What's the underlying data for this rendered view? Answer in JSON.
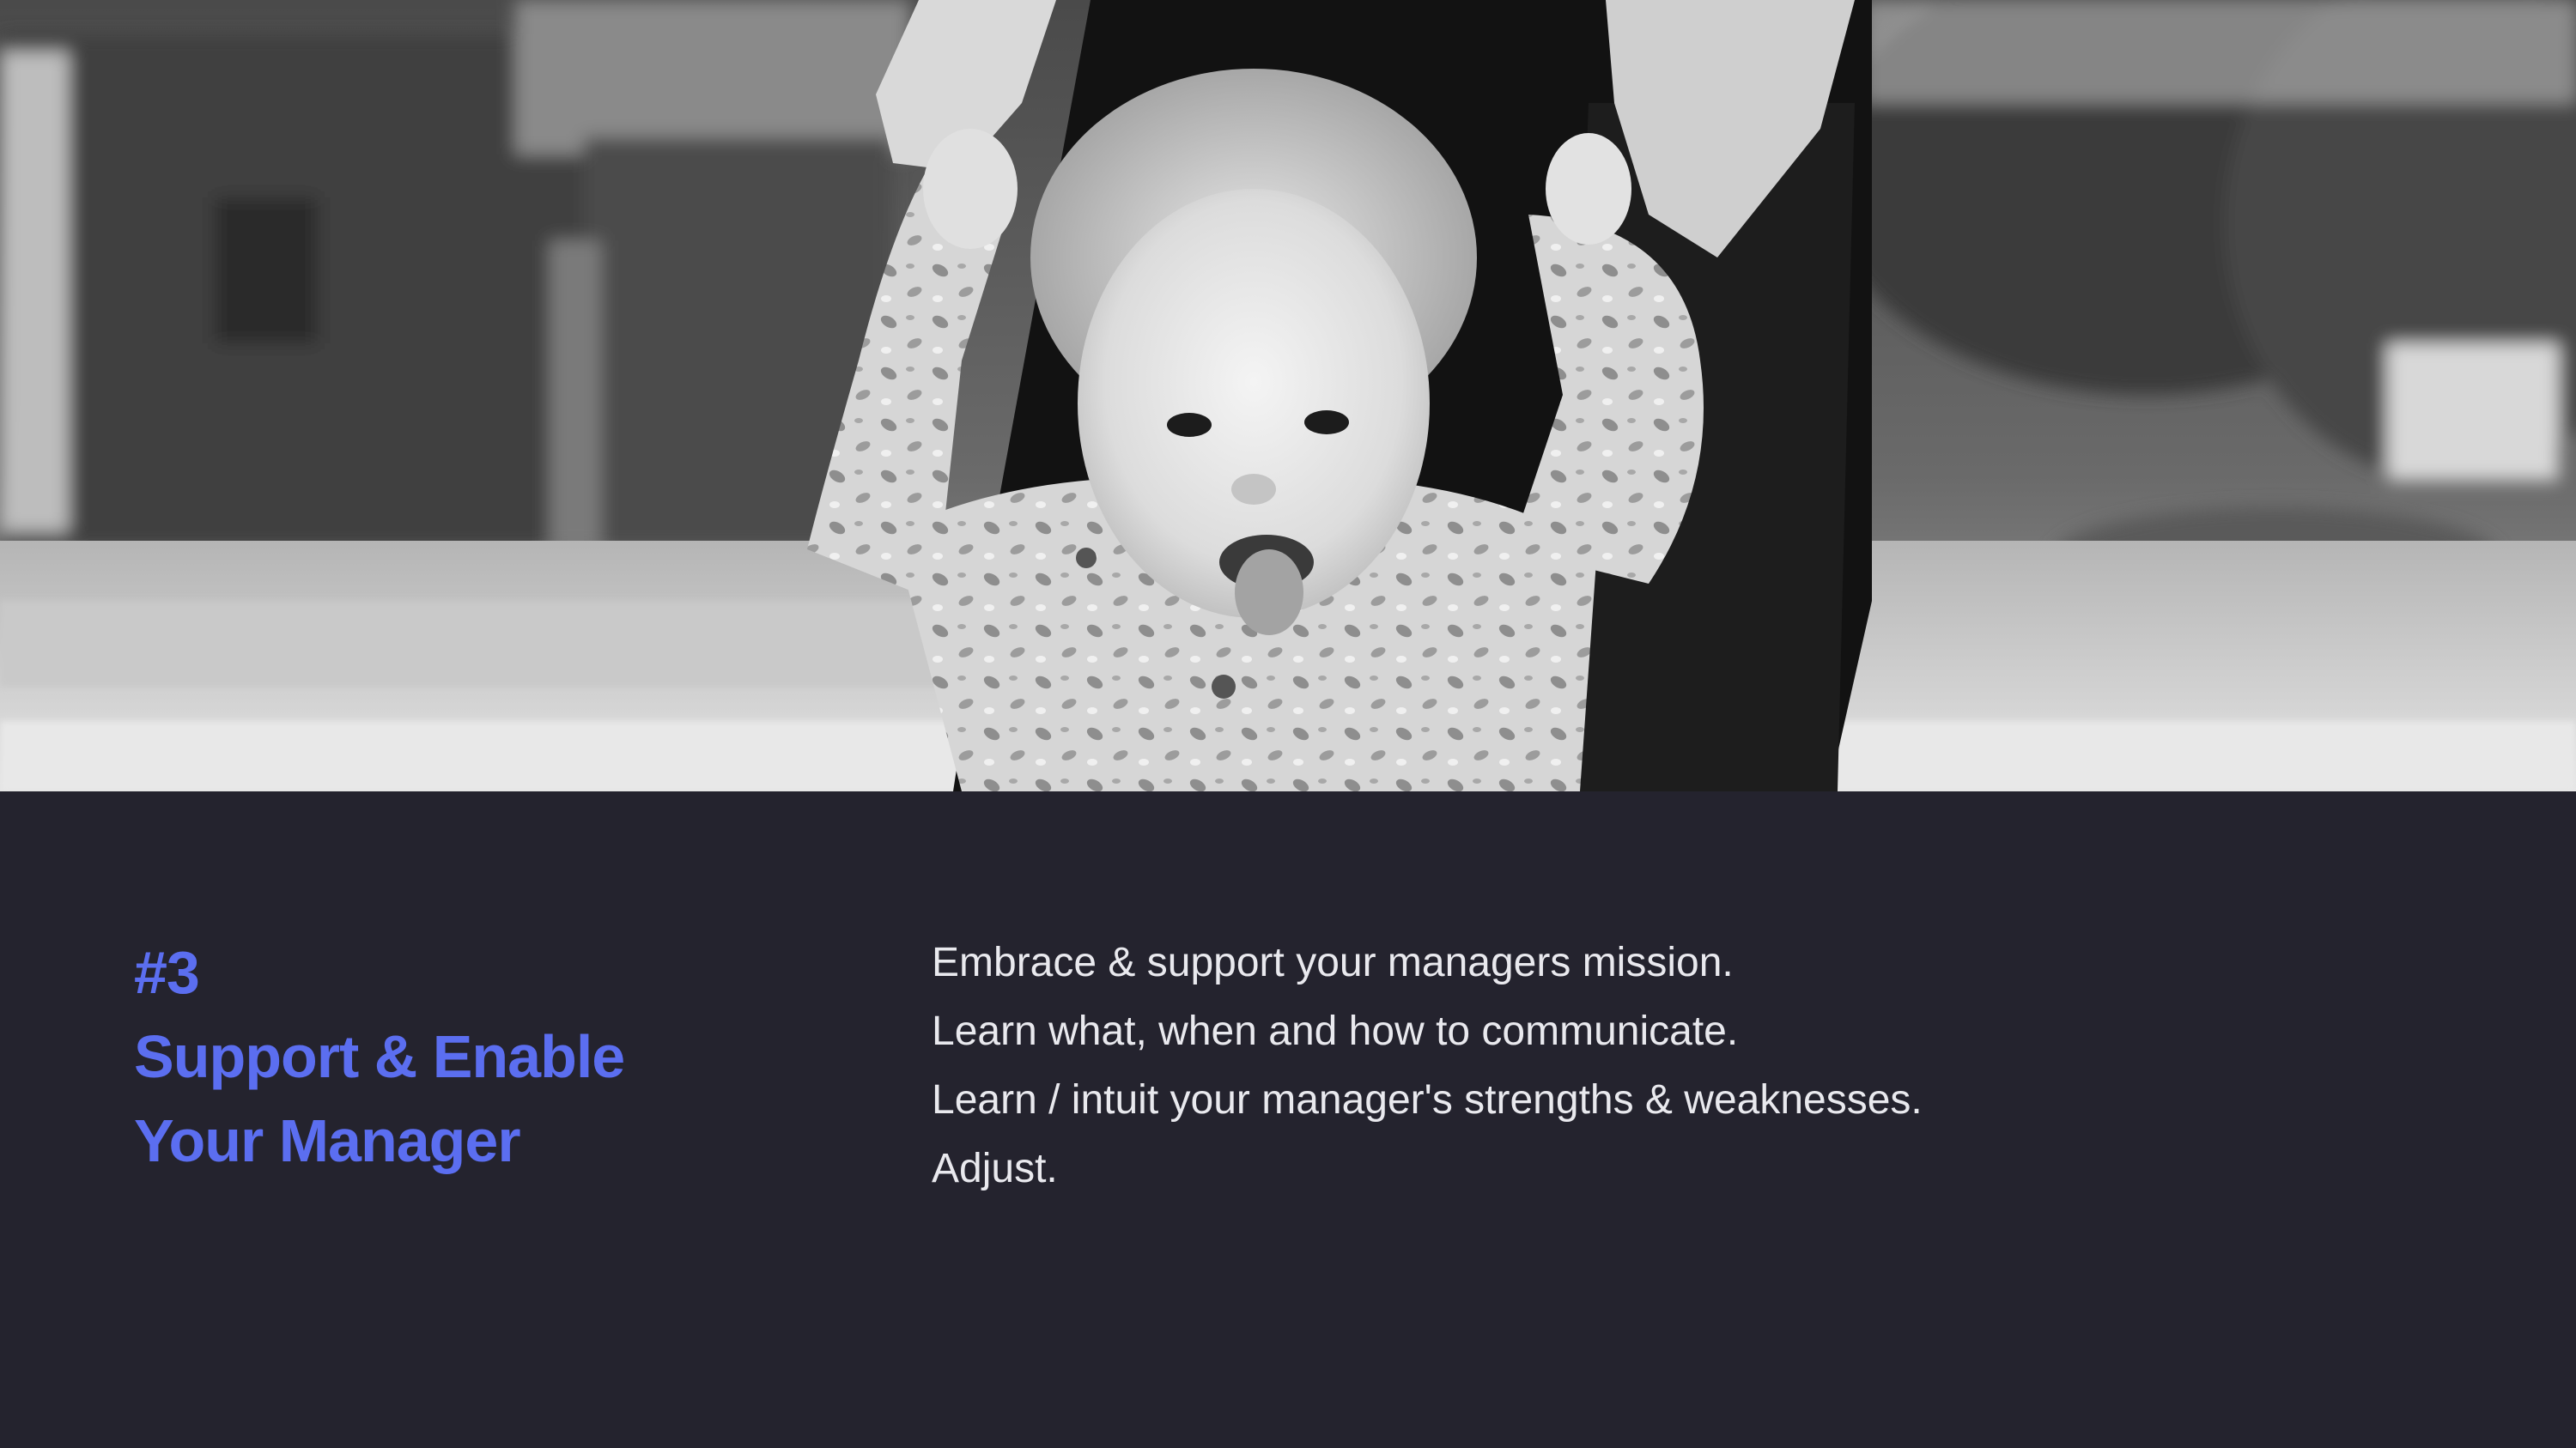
{
  "slide": {
    "number_label": "#3",
    "title_line1": "Support & Enable",
    "title_line2": "Your Manager",
    "lines": [
      "Embrace & support your managers mission.",
      "Learn what, when and how to communicate.",
      "Learn / intuit your manager's strengths & weaknesses.",
      "Adjust."
    ]
  },
  "colors": {
    "background": "#24232e",
    "heading": "#5b6ef0",
    "body_text": "#e9e9ee"
  }
}
